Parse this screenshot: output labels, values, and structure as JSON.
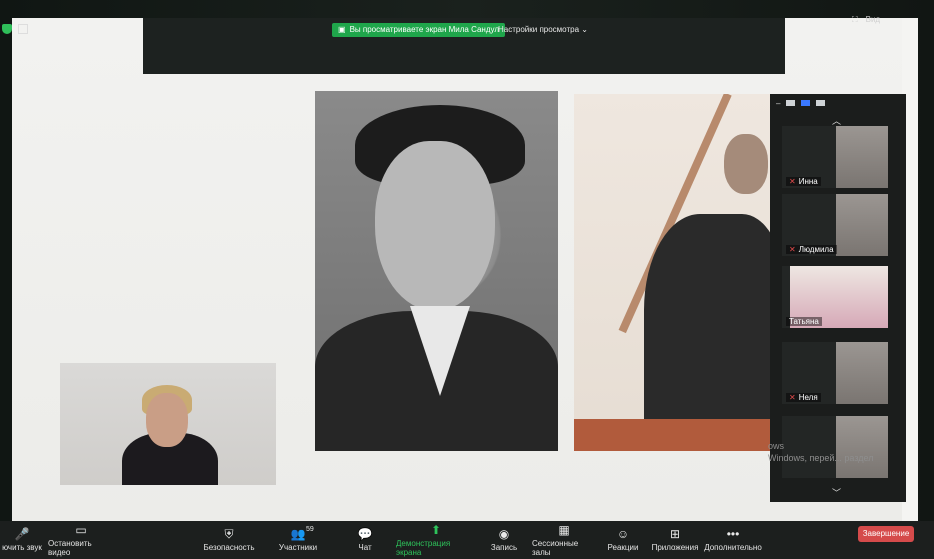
{
  "share_banner": {
    "text": "Вы просматриваете экран Мила Сандул",
    "view_options": "Настройки просмотра"
  },
  "top_right": {
    "label": "Вид"
  },
  "participants": [
    {
      "name": "Инна"
    },
    {
      "name": "Людмила"
    },
    {
      "name": "Татьяна"
    },
    {
      "name": "Неля"
    },
    {
      "name": ""
    }
  ],
  "watermark": {
    "line1": "ows",
    "line2": "Windows, перей... раздел"
  },
  "toolbar": {
    "unmute": "ючить звук",
    "video": "Остановить видео",
    "security": "Безопасность",
    "participants": "Участники",
    "participants_count": "59",
    "chat": "Чат",
    "share": "Демонстрация экрана",
    "record": "Запись",
    "breakout": "Сессионные залы",
    "reactions": "Реакции",
    "apps": "Приложения",
    "more": "Дополнительно",
    "end": "Завершение"
  },
  "colors": {
    "accent": "#2ec35b",
    "end": "#d54b4b",
    "muted": "#e04b4b"
  }
}
